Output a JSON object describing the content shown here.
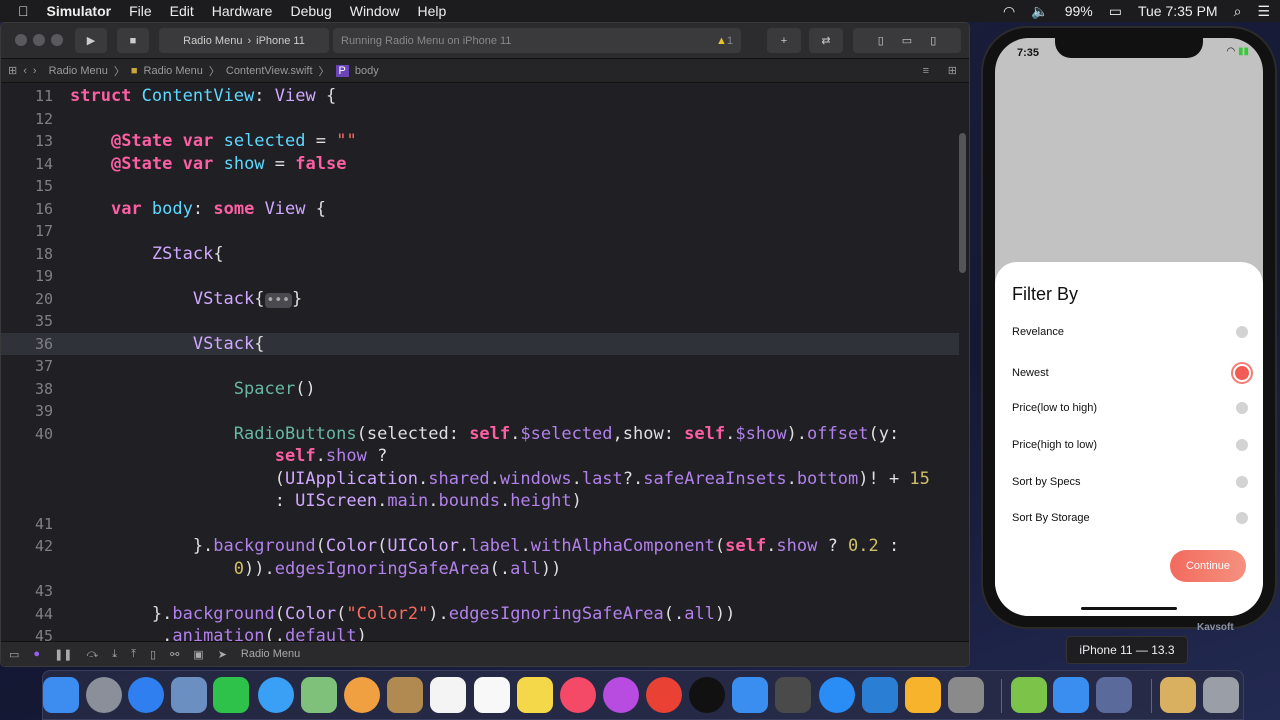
{
  "menubar": {
    "app": "Simulator",
    "items": [
      "File",
      "Edit",
      "Hardware",
      "Debug",
      "Window",
      "Help"
    ],
    "battery": "99%",
    "clock": "Tue 7:35 PM"
  },
  "toolbar": {
    "scheme": "Radio Menu",
    "device": "iPhone 11",
    "status": "Running Radio Menu on iPhone 11",
    "warnings": "1"
  },
  "breadcrumb": [
    "Radio Menu",
    "Radio Menu",
    "ContentView.swift",
    "body"
  ],
  "editor": {
    "current_line": "36",
    "lines": [
      {
        "n": "11",
        "t": [
          [
            "struct",
            "k"
          ],
          " ",
          [
            "ContentView",
            "n"
          ],
          ": ",
          [
            "View",
            "t"
          ],
          " {"
        ]
      },
      {
        "n": "12",
        "t": []
      },
      {
        "n": "13",
        "t": [
          "    ",
          [
            "@State",
            "k"
          ],
          " ",
          [
            "var",
            "k"
          ],
          " ",
          [
            "selected",
            "n"
          ],
          " = ",
          [
            "\"\"",
            "s"
          ]
        ]
      },
      {
        "n": "14",
        "t": [
          "    ",
          [
            "@State",
            "k"
          ],
          " ",
          [
            "var",
            "k"
          ],
          " ",
          [
            "show",
            "n"
          ],
          " = ",
          [
            "false",
            "k"
          ]
        ]
      },
      {
        "n": "15",
        "t": []
      },
      {
        "n": "16",
        "t": [
          "    ",
          [
            "var",
            "k"
          ],
          " ",
          [
            "body",
            "n"
          ],
          ": ",
          [
            "some",
            "k"
          ],
          " ",
          [
            "View",
            "t"
          ],
          " {"
        ]
      },
      {
        "n": "17",
        "t": []
      },
      {
        "n": "18",
        "t": [
          "        ",
          [
            "ZStack",
            "t"
          ],
          "{"
        ]
      },
      {
        "n": "19",
        "t": []
      },
      {
        "n": "20",
        "t": [
          "            ",
          [
            "VStack",
            "t"
          ],
          "{",
          [
            "•••",
            "fold"
          ],
          "}"
        ]
      },
      {
        "n": "35",
        "t": []
      },
      {
        "n": "36",
        "t": [
          "            ",
          [
            "VStack",
            "t"
          ],
          "{"
        ]
      },
      {
        "n": "37",
        "t": []
      },
      {
        "n": "38",
        "t": [
          "                ",
          [
            "Spacer",
            "f"
          ],
          "()"
        ]
      },
      {
        "n": "39",
        "t": []
      },
      {
        "n": "40",
        "t": [
          "                ",
          [
            "RadioButtons",
            "f"
          ],
          "(selected: ",
          [
            "self",
            "k"
          ],
          ".",
          [
            "$selected",
            "p"
          ],
          ",show: ",
          [
            "self",
            "k"
          ],
          ".",
          [
            "$show",
            "p"
          ],
          ").",
          [
            "offset",
            "p"
          ],
          "(y:"
        ]
      },
      {
        "n": "",
        "t": [
          "                    ",
          [
            "self",
            "k"
          ],
          ".",
          [
            "show",
            "p"
          ],
          " ?"
        ]
      },
      {
        "n": "",
        "t": [
          "                    (",
          [
            "UIApplication",
            "t"
          ],
          ".",
          [
            "shared",
            "p"
          ],
          ".",
          [
            "windows",
            "p"
          ],
          ".",
          [
            "last",
            "p"
          ],
          "?.",
          [
            "safeAreaInsets",
            "p"
          ],
          ".",
          [
            "bottom",
            "p"
          ],
          ")! + ",
          [
            "15",
            "d"
          ]
        ]
      },
      {
        "n": "",
        "t": [
          "                    : ",
          [
            "UIScreen",
            "t"
          ],
          ".",
          [
            "main",
            "p"
          ],
          ".",
          [
            "bounds",
            "p"
          ],
          ".",
          [
            "height",
            "p"
          ],
          ")"
        ]
      },
      {
        "n": "41",
        "t": []
      },
      {
        "n": "42",
        "t": [
          "            }.",
          [
            "background",
            "p"
          ],
          "(",
          [
            "Color",
            "t"
          ],
          "(",
          [
            "UIColor",
            "t"
          ],
          ".",
          [
            "label",
            "p"
          ],
          ".",
          [
            "withAlphaComponent",
            "p"
          ],
          "(",
          [
            "self",
            "k"
          ],
          ".",
          [
            "show",
            "p"
          ],
          " ? ",
          [
            "0.2",
            "d"
          ],
          " :"
        ]
      },
      {
        "n": "",
        "t": [
          "                ",
          [
            "0",
            "d"
          ],
          ")).",
          [
            "edgesIgnoringSafeArea",
            "p"
          ],
          "(.",
          [
            "all",
            "p"
          ],
          "))"
        ]
      },
      {
        "n": "43",
        "t": []
      },
      {
        "n": "44",
        "t": [
          "        }.",
          [
            "background",
            "p"
          ],
          "(",
          [
            "Color",
            "t"
          ],
          "(",
          [
            "\"Color2\"",
            "s"
          ],
          ").",
          [
            "edgesIgnoringSafeArea",
            "p"
          ],
          "(.",
          [
            "all",
            "p"
          ],
          "))"
        ]
      },
      {
        "n": "45",
        "t": [
          "         .",
          [
            "animation",
            "p"
          ],
          "(.",
          [
            "default",
            "p"
          ],
          ")"
        ]
      }
    ]
  },
  "debugbar": {
    "target": "Radio Menu"
  },
  "phone": {
    "time": "7:35",
    "title": "Filter By",
    "options": [
      {
        "label": "Revelance",
        "selected": false
      },
      {
        "label": "Newest",
        "selected": true
      },
      {
        "label": "Price(low to high)",
        "selected": false
      },
      {
        "label": "Price(high to low)",
        "selected": false
      },
      {
        "label": "Sort by Specs",
        "selected": false
      },
      {
        "label": "Sort By Storage",
        "selected": false
      }
    ],
    "continue": "Continue",
    "accent": "#f26b5e"
  },
  "sim_label": "iPhone 11 — 13.3",
  "watermark": "Kavsoft",
  "dock": [
    {
      "name": "finder",
      "color": "#3d8cf0"
    },
    {
      "name": "launchpad",
      "color": "#8a8f99"
    },
    {
      "name": "safari",
      "color": "#2f7ff0"
    },
    {
      "name": "preview",
      "color": "#6a8fc0"
    },
    {
      "name": "facetime",
      "color": "#2fc24a"
    },
    {
      "name": "messages",
      "color": "#3aa0f5"
    },
    {
      "name": "maps",
      "color": "#7fc07a"
    },
    {
      "name": "photos",
      "color": "#f0a040"
    },
    {
      "name": "contacts",
      "color": "#b08a50"
    },
    {
      "name": "calendar",
      "color": "#f4f4f4"
    },
    {
      "name": "reminders",
      "color": "#f8f8f8"
    },
    {
      "name": "notes",
      "color": "#f5d84a"
    },
    {
      "name": "music",
      "color": "#f44a68"
    },
    {
      "name": "podcasts",
      "color": "#b84be0"
    },
    {
      "name": "chrome",
      "color": "#e94235"
    },
    {
      "name": "tv",
      "color": "#111111"
    },
    {
      "name": "xcode",
      "color": "#3a8ef0"
    },
    {
      "name": "final-cut-pro",
      "color": "#4a4a4a"
    },
    {
      "name": "app-store",
      "color": "#2a8cf5"
    },
    {
      "name": "vscode",
      "color": "#2a7fd4"
    },
    {
      "name": "sketch",
      "color": "#f7b32b"
    },
    {
      "name": "system-preferences",
      "color": "#8a8a8a"
    },
    {
      "name": "android-studio",
      "color": "#7cc34a"
    },
    {
      "name": "simulator",
      "color": "#3a8ef0"
    },
    {
      "name": "quicktime",
      "color": "#5a6a9a"
    },
    {
      "name": "archive-utility",
      "color": "#d8b060"
    },
    {
      "name": "trash",
      "color": "#9a9ea6"
    }
  ]
}
